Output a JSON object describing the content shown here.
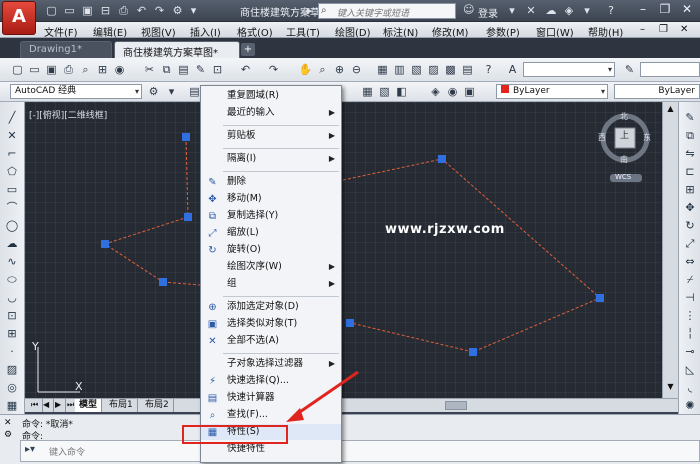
{
  "app": {
    "logo": "A",
    "title": "商住楼建筑方案草..."
  },
  "search": {
    "placeholder": "键入关键字或短语"
  },
  "user": {
    "login": "登录"
  },
  "menu": [
    "文件(F)",
    "编辑(E)",
    "视图(V)",
    "插入(I)",
    "格式(O)",
    "工具(T)",
    "绘图(D)",
    "标注(N)",
    "修改(M)",
    "参数(P)",
    "窗口(W)",
    "帮助(H)"
  ],
  "tabs": [
    {
      "label": "Drawing1*"
    },
    {
      "label": "商住楼建筑方案草图*"
    }
  ],
  "toolbar2": {
    "workspace": "AutoCAD 经典",
    "color": "ByLayer",
    "linetype": "ByLayer"
  },
  "viewport": {
    "label": "[-][俯视][二维线框]"
  },
  "viewcube": {
    "top": "上",
    "north": "北",
    "south": "南",
    "east": "东",
    "west": "西",
    "ucs": "WCS"
  },
  "watermark": "www.rjzxw.com",
  "axis": {
    "y": "Y",
    "x": "X"
  },
  "layout_tabs": [
    "模型",
    "布局1",
    "布局2"
  ],
  "command": {
    "line1": "命令: *取消*",
    "line2": "命令:",
    "placeholder": "键入命令"
  },
  "context_menu": [
    {
      "label": "重复圆域(R)",
      "icon": "",
      "arrow": false
    },
    {
      "label": "最近的输入",
      "icon": "",
      "arrow": true
    },
    {
      "label": "剪贴板",
      "icon": "",
      "arrow": true
    },
    {
      "label": "隔离(I)",
      "icon": "",
      "arrow": true
    },
    {
      "label": "删除",
      "icon": "eraser-icon",
      "arrow": false
    },
    {
      "label": "移动(M)",
      "icon": "move-icon",
      "arrow": false
    },
    {
      "label": "复制选择(Y)",
      "icon": "copy-icon",
      "arrow": false
    },
    {
      "label": "缩放(L)",
      "icon": "scale-icon",
      "arrow": false
    },
    {
      "label": "旋转(O)",
      "icon": "rotate-icon",
      "arrow": false
    },
    {
      "label": "绘图次序(W)",
      "icon": "",
      "arrow": true
    },
    {
      "label": "组",
      "icon": "",
      "arrow": true
    },
    {
      "label": "添加选定对象(D)",
      "icon": "add-selected-icon",
      "arrow": false
    },
    {
      "label": "选择类似对象(T)",
      "icon": "select-similar-icon",
      "arrow": false
    },
    {
      "label": "全部不选(A)",
      "icon": "deselect-all-icon",
      "arrow": false
    },
    {
      "label": "子对象选择过滤器",
      "icon": "",
      "arrow": true
    },
    {
      "label": "快速选择(Q)...",
      "icon": "quick-select-icon",
      "arrow": false
    },
    {
      "label": "快速计算器",
      "icon": "calculator-icon",
      "arrow": false
    },
    {
      "label": "查找(F)...",
      "icon": "find-icon",
      "arrow": false
    },
    {
      "label": "特性(S)",
      "icon": "properties-icon",
      "arrow": false
    },
    {
      "label": "快捷特性",
      "icon": "",
      "arrow": false
    }
  ],
  "colors": {
    "accent_red": "#e0251e",
    "grip_blue": "#2f6fe0",
    "dash_line": "#e0603a",
    "canvas": "#252a33"
  }
}
